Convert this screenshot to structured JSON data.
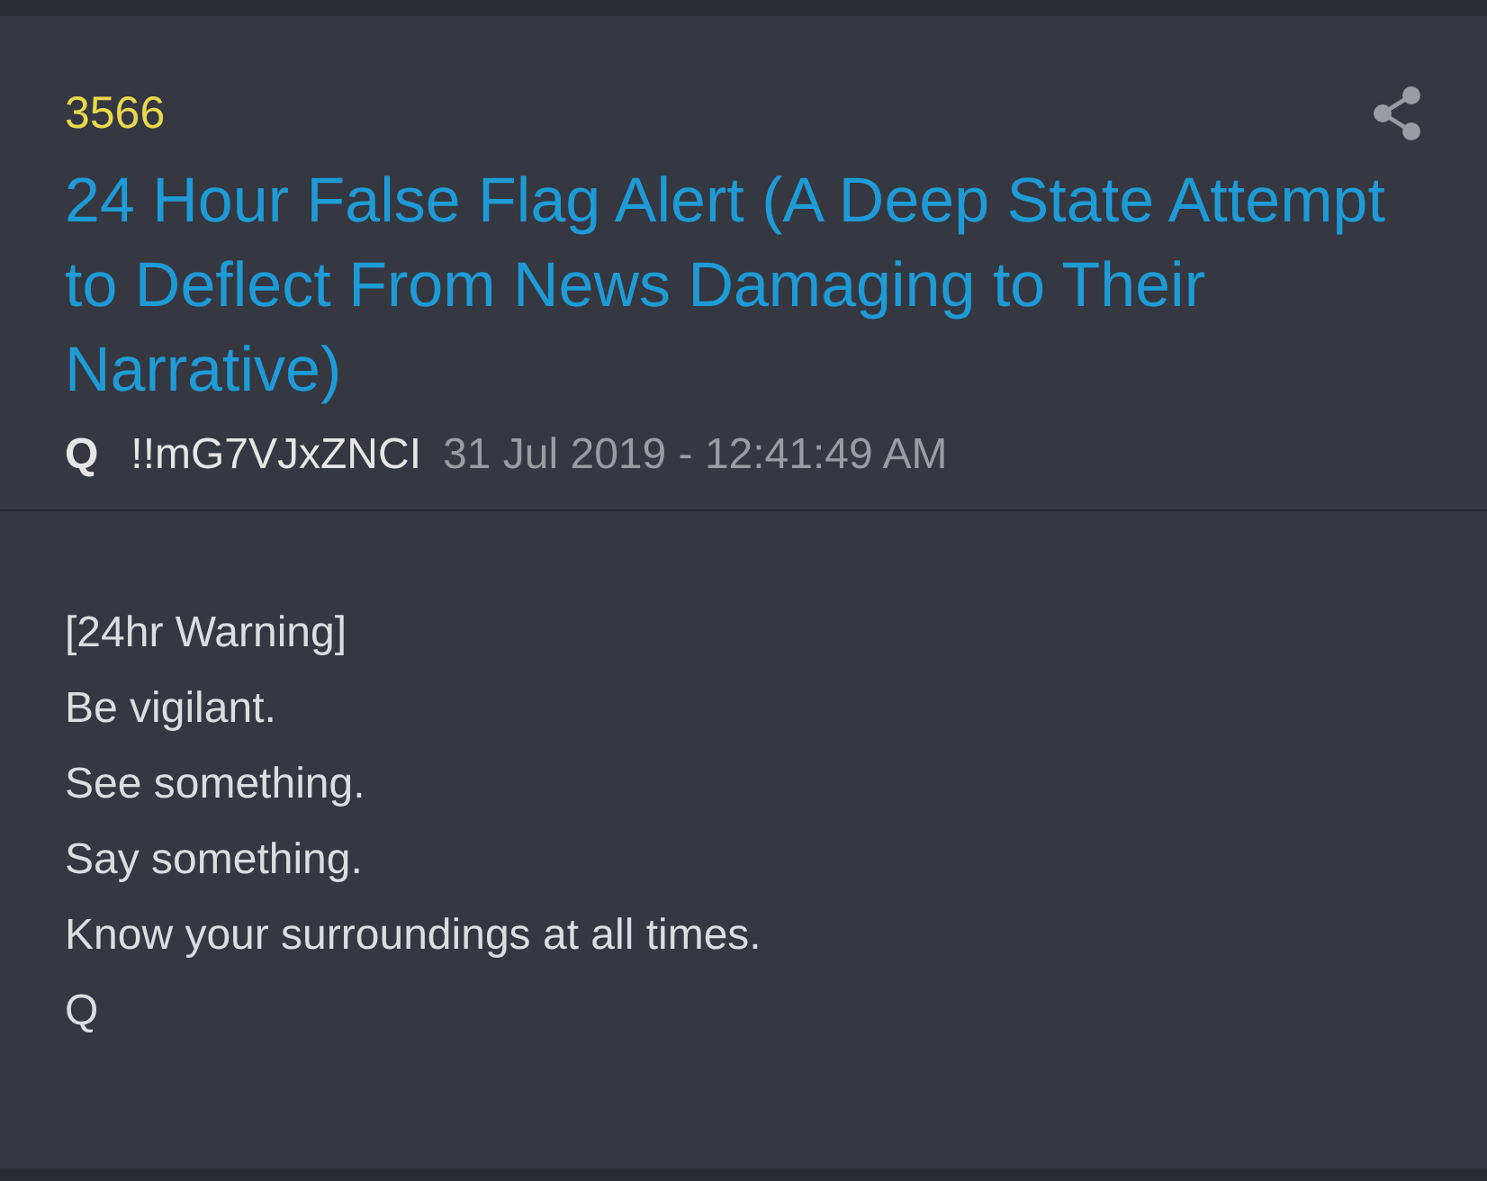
{
  "post": {
    "number": "3566",
    "title": "24 Hour False Flag Alert (A Deep State Attempt to Deflect From News Damaging to Their Narrative)",
    "author": "Q",
    "tripcode": "!!mG7VJxZNCI",
    "timestamp": "31 Jul 2019 - 12:41:49 AM",
    "body": [
      "[24hr Warning]",
      "Be vigilant.",
      "See something.",
      "Say something.",
      "Know your surroundings at all times.",
      "Q"
    ]
  }
}
